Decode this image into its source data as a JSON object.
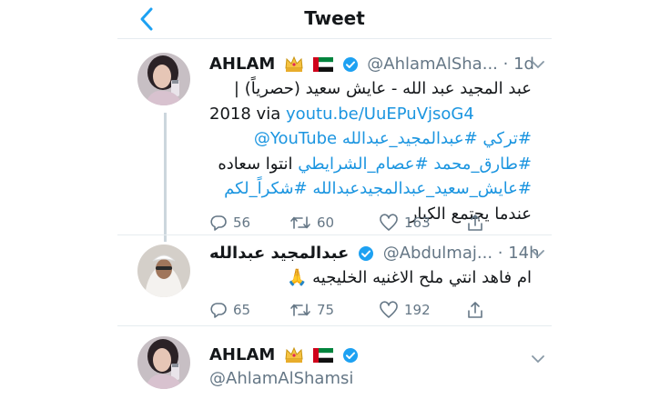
{
  "header": {
    "title": "Tweet"
  },
  "tweets": [
    {
      "name": "AHLAM",
      "handle": "@AhlamAlSha...",
      "time": "· 1d",
      "lines": [
        "عبد المجيد عبد الله - عايش سعيد (حصرياً) |",
        "2018",
        "via",
        "youtu.be/UuEPuVjsoG4",
        "@YouTube",
        "#عبدالمجيد_عبدالله",
        "#تركي",
        "#طارق_محمد",
        "#عصام_الشرايطي",
        "انتوا سعاده",
        "#عايش_سعيد_عبدالمجيدعبدالله",
        "#شكراً_لكم",
        "عندما يجتمع الكبار"
      ],
      "replies": "56",
      "retweets": "60",
      "likes": "163"
    },
    {
      "name": "عبدالمجيد عبدالله",
      "handle": "@Abdulmaj...",
      "time": "· 14h",
      "text": "ام فاهد انتي ملح الاغنيه الخليجيه 🙏",
      "replies": "65",
      "retweets": "75",
      "likes": "192"
    },
    {
      "name": "AHLAM",
      "handle": "@AhlamAlShamsi"
    }
  ],
  "colors": {
    "link": "#1b95e0",
    "verified": "#1da1f2",
    "muted": "#657786",
    "divider": "#e6ecf0"
  },
  "icons": [
    "back-chevron-icon",
    "crown-icon",
    "uae-flag-icon",
    "verified-badge-icon",
    "caret-down-icon",
    "reply-icon",
    "retweet-icon",
    "like-icon",
    "share-icon",
    "praying-hands-icon"
  ]
}
